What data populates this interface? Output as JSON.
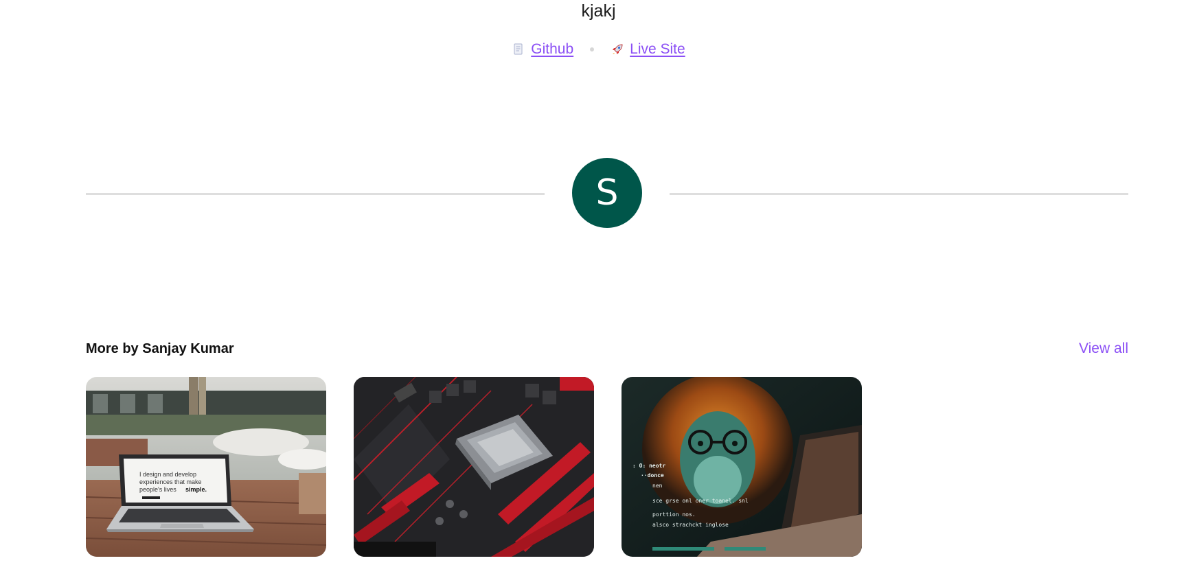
{
  "project": {
    "title": "kjakj"
  },
  "links": [
    {
      "label": "Github",
      "icon": "document-icon"
    },
    {
      "label": "Live Site",
      "icon": "rocket-icon"
    }
  ],
  "author": {
    "avatar_initial": "S",
    "avatar_color": "#00564a"
  },
  "more": {
    "title": "More by Sanjay Kumar",
    "view_all_label": "View all",
    "cards": [
      {
        "image": "laptop-on-table-photo",
        "screen_text": [
          "I design and develop",
          "experiences that make",
          "people's lives",
          "simple."
        ]
      },
      {
        "image": "motherboard-cpu-photo"
      },
      {
        "image": "lion-with-glasses-coding-photo",
        "screen_text": [
          ": O: neotr",
          "··donce",
          "nen",
          "sce  grse onl oner toanel. snl",
          "porttion nos.",
          "alsco strachckt inglose"
        ]
      }
    ]
  },
  "colors": {
    "accent": "#8b4ff5",
    "divider": "#dedede",
    "avatar": "#00564a"
  }
}
